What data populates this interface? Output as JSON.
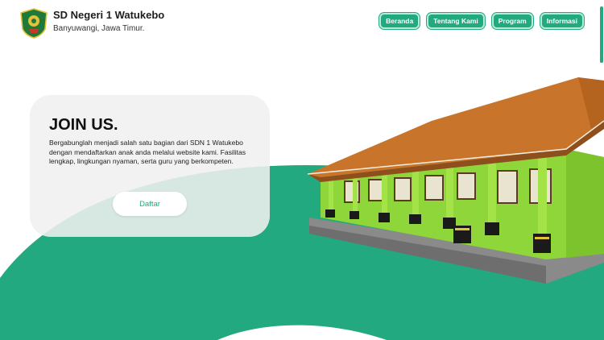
{
  "header": {
    "school_name": "SD Negeri 1 Watukebo",
    "location": "Banyuwangi, Jawa Timur."
  },
  "nav": {
    "items": [
      {
        "label": "Beranda"
      },
      {
        "label": "Tentang Kami"
      },
      {
        "label": "Program"
      },
      {
        "label": "Informasi"
      }
    ]
  },
  "hero": {
    "title": "JOIN US.",
    "description": "Bergabunglah menjadi salah satu bagian dari SDN 1 Watukebo dengan mendaftarkan anak anda melalui website kami. Fasilitas lengkap, lingkungan nyaman, serta guru yang berkompeten.",
    "cta_label": "Daftar"
  },
  "colors": {
    "accent": "#22a97f",
    "nav_border": "#b7ecd8",
    "building_wall": "#8fd63a",
    "roof": "#c8742b"
  },
  "icons": {
    "logo": "school-emblem-icon"
  }
}
